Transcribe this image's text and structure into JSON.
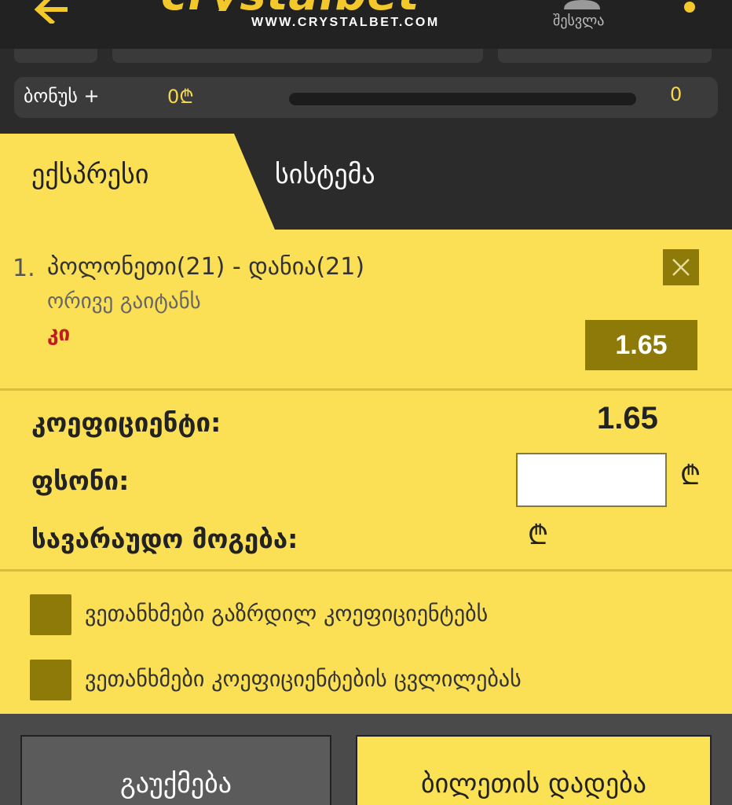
{
  "header": {
    "logo_text": "crystalbet",
    "logo_url": "WWW.CRYSTALBET.COM",
    "login_label": "შესვლა"
  },
  "bonus": {
    "label": "ბონუს +",
    "value": "0₾",
    "count": "0"
  },
  "tabs": [
    {
      "label": "ექსპრესი",
      "active": true
    },
    {
      "label": "სისტემა",
      "active": false
    }
  ],
  "bet": {
    "number": "1.",
    "match": "პოლონეთი(21) - დანია(21)",
    "market": "ორივე გაიტანს",
    "pick": "კი",
    "odds": "1.65"
  },
  "summary": {
    "odds_label": "კოეფიციენტი:",
    "odds_value": "1.65",
    "stake_label": "ფსონი:",
    "stake_value": "",
    "win_label": "სავარაუდო მოგება:",
    "currency": "₾"
  },
  "options": [
    {
      "label": "ვეთანხმები გაზრდილ კოეფიციენტებს"
    },
    {
      "label": "ვეთანხმები კოეფიციენტების ცვლილებას"
    }
  ],
  "actions": {
    "cancel_label": "გაუქმება",
    "place_label": "ბილეთის დადება"
  },
  "colors": {
    "accent": "#fbdf55",
    "dark": "#222222",
    "olive": "#8e7a08",
    "pick_red": "#c01e1e"
  }
}
